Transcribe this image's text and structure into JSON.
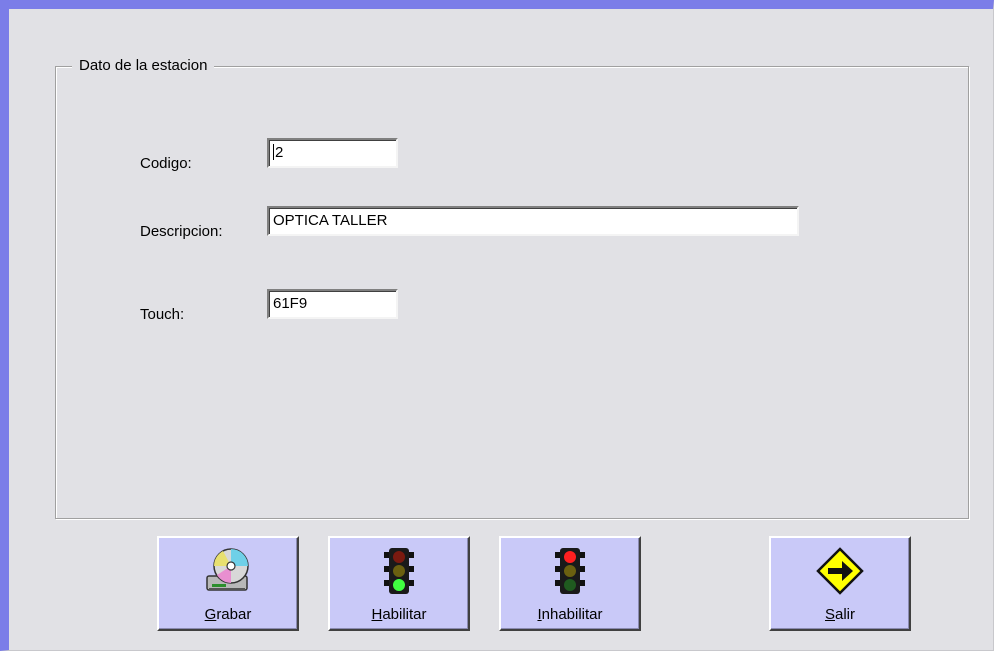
{
  "groupbox": {
    "title": "Dato de la estacion"
  },
  "fields": {
    "codigo": {
      "label": "Codigo:",
      "value": "2"
    },
    "descripcion": {
      "label": "Descripcion:",
      "value": "OPTICA TALLER"
    },
    "touch": {
      "label": "Touch:",
      "value": "61F9"
    }
  },
  "buttons": {
    "grabar": {
      "mnemonic": "G",
      "rest": "rabar",
      "icon": "cd-drive-icon"
    },
    "habilitar": {
      "mnemonic": "H",
      "rest": "abilitar",
      "icon": "traffic-light-green-icon"
    },
    "inhabilitar": {
      "mnemonic": "I",
      "rest": "nhabilitar",
      "icon": "traffic-light-red-icon"
    },
    "salir": {
      "mnemonic": "S",
      "rest": "alir",
      "icon": "exit-arrow-sign-icon"
    }
  },
  "colors": {
    "window_bg": "#e1e1e5",
    "window_border": "#7b7de8",
    "button_bg": "#c9c9f8"
  }
}
